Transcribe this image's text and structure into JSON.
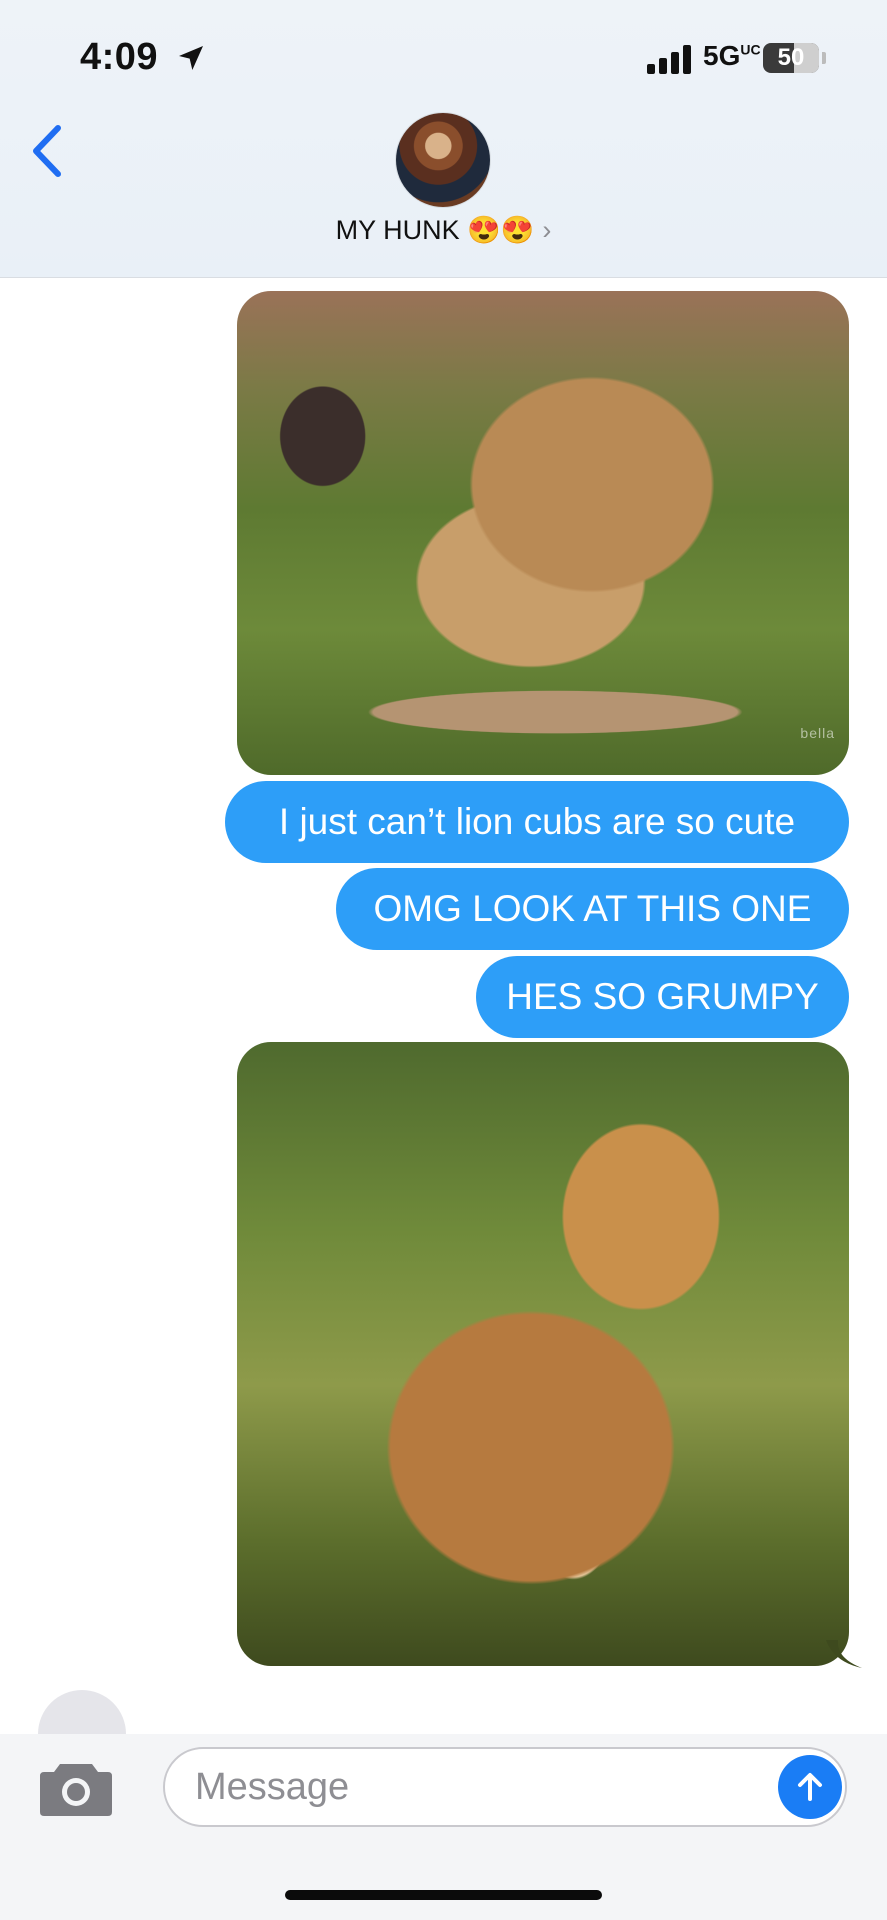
{
  "status_bar": {
    "time": "4:09",
    "network": "5G",
    "network_suffix": "UC",
    "battery": "50",
    "icons": [
      "location-arrow-icon",
      "cellular-signal-icon",
      "battery-icon"
    ]
  },
  "header": {
    "back_icon": "chevron-left-icon",
    "contact_name": "MY HUNK 😍😍",
    "chevron": "›"
  },
  "conversation": {
    "photo1_watermark": "bella",
    "bubbles": [
      "I just can’t lion cubs are so cute",
      "OMG LOOK AT THIS ONE",
      "HES SO GRUMPY"
    ]
  },
  "composer": {
    "placeholder": "Message",
    "camera_icon": "camera-icon",
    "send_icon": "arrow-up-icon"
  },
  "colors": {
    "bubble_blue": "#2d9ef8",
    "send_blue": "#1a7df5",
    "accent_back": "#1f6df2"
  }
}
